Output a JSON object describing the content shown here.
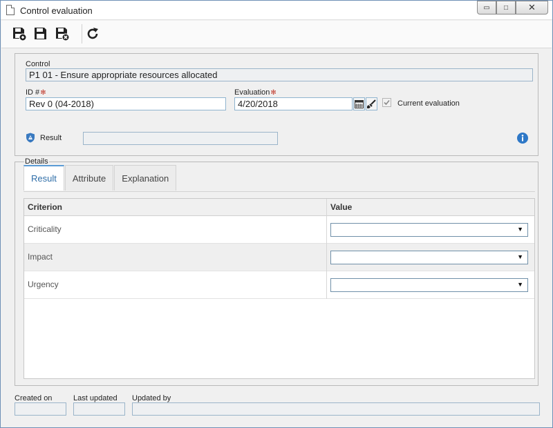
{
  "window": {
    "title": "Control evaluation",
    "buttons": {
      "minimize": "▭",
      "maximize": "□",
      "close": "✕"
    }
  },
  "toolbar": {
    "items": [
      {
        "icon": "save-new-icon"
      },
      {
        "icon": "save-icon"
      },
      {
        "icon": "save-close-icon"
      },
      {
        "icon": "refresh-icon"
      }
    ]
  },
  "form": {
    "control_label": "Control",
    "control_value": "P1 01 - Ensure appropriate resources allocated",
    "id_label": "ID #",
    "id_value": "Rev 0 (04-2018)",
    "evaluation_label": "Evaluation",
    "evaluation_value": "4/20/2018",
    "current_evaluation_label": "Current evaluation",
    "current_evaluation_checked": true,
    "result_label": "Result",
    "result_value": "",
    "required_marker": "✻"
  },
  "details": {
    "legend": "Details",
    "tabs": [
      {
        "label": "Result",
        "active": true
      },
      {
        "label": "Attribute",
        "active": false
      },
      {
        "label": "Explanation",
        "active": false
      }
    ],
    "grid": {
      "columns": [
        "Criterion",
        "Value"
      ],
      "rows": [
        {
          "criterion": "Criticality",
          "value": ""
        },
        {
          "criterion": "Impact",
          "value": ""
        },
        {
          "criterion": "Urgency",
          "value": ""
        }
      ]
    },
    "select_arrow": "▼"
  },
  "footer": {
    "created_on_label": "Created on",
    "created_on_value": "",
    "last_updated_label": "Last updated",
    "last_updated_value": "",
    "updated_by_label": "Updated by",
    "updated_by_value": ""
  },
  "colors": {
    "accent": "#2f6ea8",
    "info": "#2e78c7",
    "required": "#c0392b"
  }
}
